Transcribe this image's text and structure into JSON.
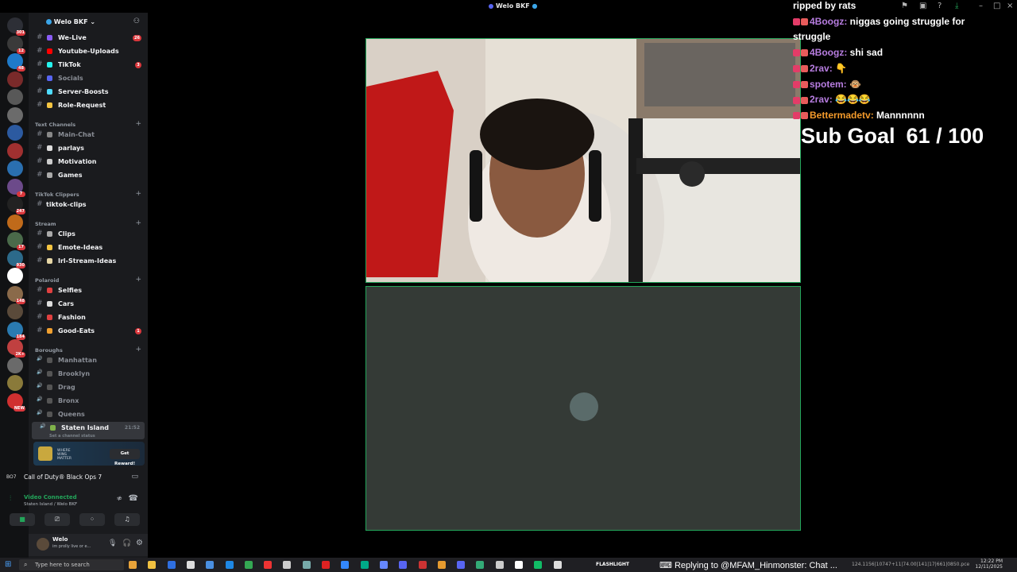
{
  "window": {
    "title": "Welo BKF"
  },
  "rail": {
    "servers": [
      {
        "badge": "301",
        "color": "#2d2f36"
      },
      {
        "badge": "12",
        "color": "#3a3a3a"
      },
      {
        "badge": "48",
        "color": "#1f7ac9"
      },
      {
        "badge": "",
        "color": "#7a2a2a"
      },
      {
        "badge": "",
        "color": "#585858"
      },
      {
        "badge": "",
        "color": "#6b6b6b"
      },
      {
        "badge": "",
        "color": "#2c5aa0"
      },
      {
        "badge": "",
        "color": "#a03030"
      },
      {
        "badge": "",
        "color": "#2a6fb0"
      },
      {
        "badge": "7",
        "color": "#6c4a8a"
      },
      {
        "badge": "247",
        "color": "#222"
      },
      {
        "badge": "",
        "color": "#c06a1a"
      },
      {
        "badge": "17",
        "color": "#4a6a4a"
      },
      {
        "badge": "930",
        "color": "#2c6a8a"
      },
      {
        "badge": "",
        "color": "#ffffff"
      },
      {
        "badge": "148",
        "color": "#8a6a4a"
      },
      {
        "badge": "",
        "color": "#5a4a3a"
      },
      {
        "badge": "184",
        "color": "#2a7ab0"
      },
      {
        "badge": "2K+",
        "color": "#c04040"
      },
      {
        "badge": "",
        "color": "#6a6a6a"
      },
      {
        "badge": "",
        "color": "#8a7a3a"
      },
      {
        "badge": "NEW",
        "color": "#d03030"
      }
    ]
  },
  "sidebar": {
    "server_name": "Welo BKF",
    "top_channels": [
      {
        "label": "We-Live",
        "emoji_color": "#8a5cf6",
        "count": "26"
      },
      {
        "label": "Youtube-Uploads",
        "emoji_color": "#ff0000",
        "count": ""
      },
      {
        "label": "TikTok",
        "emoji_color": "#25f4ee",
        "count": "3"
      },
      {
        "label": "Socials",
        "emoji_color": "#5865f2",
        "count": ""
      },
      {
        "label": "Server-Boosts",
        "emoji_color": "#4fdcff",
        "count": ""
      },
      {
        "label": "Role-Request",
        "emoji_color": "#f5c542",
        "count": ""
      }
    ],
    "cat_text": "Text Channels",
    "text_channels": [
      {
        "label": "Main-Chat",
        "emoji_color": "#888",
        "muted": true
      },
      {
        "label": "parlays",
        "emoji_color": "#ddd",
        "muted": false
      },
      {
        "label": "Motivation",
        "emoji_color": "#ccc",
        "muted": false
      },
      {
        "label": "Games",
        "emoji_color": "#aaa",
        "muted": false
      }
    ],
    "cat_tiktok": "TikTok Clippers",
    "tiktok_channels": [
      {
        "label": "tiktok-clips"
      }
    ],
    "cat_stream": "Stream",
    "stream_channels": [
      {
        "label": "Clips",
        "emoji_color": "#aaa"
      },
      {
        "label": "Emote-Ideas",
        "emoji_color": "#f5c542"
      },
      {
        "label": "Irl-Stream-Ideas",
        "emoji_color": "#e6d6a6"
      }
    ],
    "cat_polaroid": "Polaroid",
    "polaroid_channels": [
      {
        "label": "Selfies",
        "emoji_color": "#e04040",
        "count": ""
      },
      {
        "label": "Cars",
        "emoji_color": "#ddd",
        "count": ""
      },
      {
        "label": "Fashion",
        "emoji_color": "#e04040",
        "count": ""
      },
      {
        "label": "Good-Eats",
        "emoji_color": "#f0a030",
        "count": "1"
      }
    ],
    "cat_boroughs": "Boroughs",
    "voice_channels": [
      {
        "label": "Manhattan"
      },
      {
        "label": "Brooklyn"
      },
      {
        "label": "Drag"
      },
      {
        "label": "Bronx"
      },
      {
        "label": "Queens"
      }
    ],
    "active_voice": {
      "label": "Staten Island",
      "time": "21:52",
      "status": "Set a channel status"
    }
  },
  "promo": {
    "text": "WHERE WINS MATTER",
    "button": "Get Reward!"
  },
  "game": {
    "title": "Call of Duty® Black Ops 7"
  },
  "voice": {
    "status": "Video Connected",
    "location": "Staten Island / Welo BKF"
  },
  "user": {
    "name": "Welo",
    "status": "im prolly live or e..."
  },
  "chat": [
    {
      "user": "",
      "text": "ripped by rats",
      "color": ""
    },
    {
      "user": "4Boogz:",
      "text": "niggas going struggle for",
      "color": "purple"
    },
    {
      "user": "",
      "text": "struggle",
      "color": ""
    },
    {
      "user": "4Boogz:",
      "text": "shi sad",
      "color": "purple"
    },
    {
      "user": "2rav:",
      "text": "👇",
      "color": "purple"
    },
    {
      "user": "spotem:",
      "text": "🐵",
      "color": "purple"
    },
    {
      "user": "2rav:",
      "text": "😂😂😂",
      "color": "purple"
    },
    {
      "user": "Bettermadetv:",
      "text": "Mannnnnn",
      "color": "orange"
    }
  ],
  "subgoal": {
    "label": "Sub Goal",
    "current": "61",
    "target": "100",
    "progress": 0.61
  },
  "taskbar": {
    "search_placeholder": "Type here to search",
    "flashlight": "FLASHLIGHT",
    "reply": "Replying to @MFAM_Hinmonster: Chat ...",
    "tray": "124.1156|10747+11|74.00|141|17|661|0850.pce",
    "time": "12:22 PM",
    "date": "12/11/2025"
  },
  "colors": {
    "accent": "#23a55a",
    "brand": "#5865f2",
    "badge": "#da373c"
  }
}
